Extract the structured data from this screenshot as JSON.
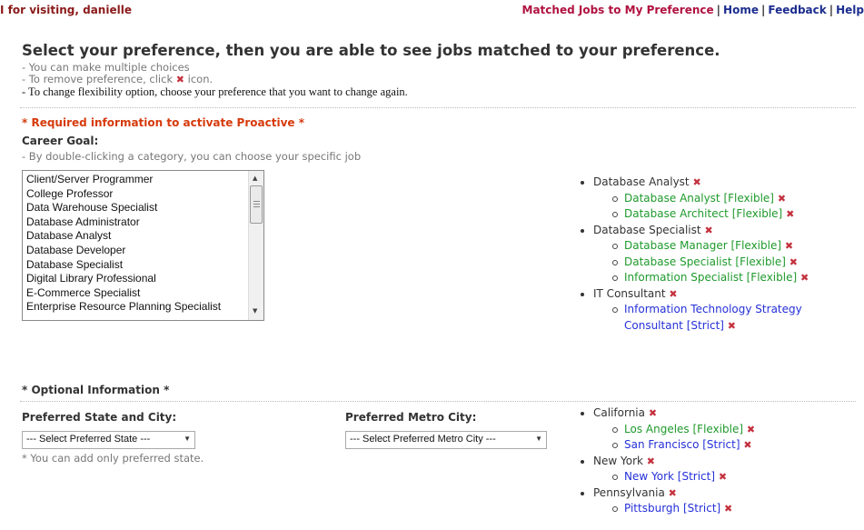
{
  "header": {
    "greeting": "I for visiting, danielle",
    "nav": [
      "Matched Jobs to My Preference",
      "Home",
      "Feedback",
      "Help"
    ]
  },
  "intro": {
    "headline": "Select your preference, then you are able to see jobs matched to your preference.",
    "note1": "- You can make multiple choices",
    "note2_pre": "- To remove preference, click",
    "note2_post": "icon.",
    "note3": "- To change flexibility option, choose your preference that you want to change again."
  },
  "required": {
    "heading": "* Required information to activate Proactive *",
    "career_label": "Career Goal:",
    "career_hint": "- By double-clicking a category, you can choose your specific job",
    "career_options": [
      "Client/Server Programmer",
      "College Professor",
      "Data Warehouse Specialist",
      "Database Administrator",
      "Database Analyst",
      "Database Developer",
      "Database Specialist",
      "Digital Library Professional",
      "E-Commerce Specialist",
      "Enterprise Resource Planning Specialist"
    ]
  },
  "selected_jobs": [
    {
      "label": "Database Analyst",
      "children": [
        {
          "label": "Database Analyst [Flexible]",
          "type": "flexible"
        },
        {
          "label": "Database Architect [Flexible]",
          "type": "flexible"
        }
      ]
    },
    {
      "label": "Database Specialist",
      "children": [
        {
          "label": "Database Manager [Flexible]",
          "type": "flexible"
        },
        {
          "label": "Database Specialist [Flexible]",
          "type": "flexible"
        },
        {
          "label": "Information Specialist [Flexible]",
          "type": "flexible"
        }
      ]
    },
    {
      "label": "IT Consultant",
      "children": [
        {
          "label": "Information Technology Strategy Consultant [Strict]",
          "type": "strict"
        }
      ]
    }
  ],
  "optional": {
    "heading": "* Optional Information *",
    "state_label": "Preferred State and City:",
    "state_select": "--- Select Preferred State ---",
    "state_hint": "* You can add only preferred state.",
    "metro_label": "Preferred Metro City:",
    "metro_select": "--- Select Preferred Metro City ---"
  },
  "selected_locations": [
    {
      "label": "California",
      "children": [
        {
          "label": "Los Angeles [Flexible]",
          "type": "flexible"
        },
        {
          "label": "San Francisco [Strict]",
          "type": "strict"
        }
      ]
    },
    {
      "label": "New York",
      "children": [
        {
          "label": "New York [Strict]",
          "type": "strict"
        }
      ]
    },
    {
      "label": "Pennsylvania",
      "children": [
        {
          "label": "Pittsburgh [Strict]",
          "type": "strict"
        }
      ]
    }
  ],
  "icons": {
    "remove": "remove-x-icon"
  },
  "colors": {
    "flexible": "#1f9a2c",
    "strict": "#2530d8",
    "required": "#d63a0c",
    "remove": "#c4313d",
    "nav_link": "#1c2d8f",
    "nav_active": "#b0123f"
  }
}
